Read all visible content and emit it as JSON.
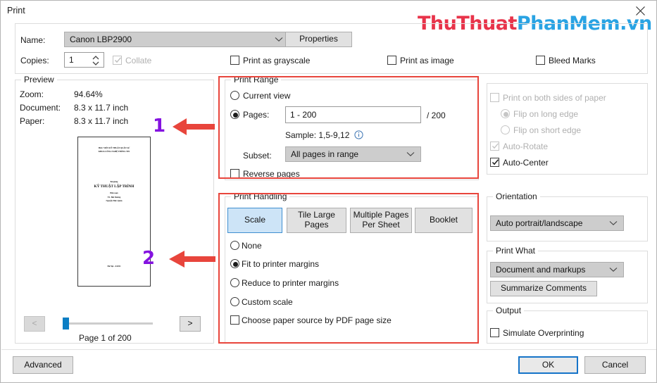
{
  "window": {
    "title": "Print",
    "close_icon": "close-icon"
  },
  "watermark": {
    "part1": "ThuThuat",
    "part2": "PhanMem.vn",
    "color1": "#e8334a",
    "color2": "#29a3e3"
  },
  "printer": {
    "name_label": "Name:",
    "name_value": "Canon LBP2900",
    "properties_button": "Properties",
    "copies_label": "Copies:",
    "copies_value": "1",
    "collate_label": "Collate",
    "collate_checked": true,
    "collate_enabled": false,
    "print_as_grayscale_label": "Print as grayscale",
    "print_as_grayscale_checked": false,
    "print_as_image_label": "Print as image",
    "print_as_image_checked": false,
    "bleed_marks_label": "Bleed Marks",
    "bleed_marks_checked": false
  },
  "preview": {
    "legend": "Preview",
    "zoom_label": "Zoom:",
    "zoom_value": "94.64%",
    "document_label": "Document:",
    "document_value": "8.3 x 11.7 inch",
    "paper_label": "Paper:",
    "paper_value": "8.3 x 11.7 inch",
    "page_status": "Page 1 of 200",
    "prev_button": "<",
    "next_button": ">",
    "prev_enabled": false,
    "next_enabled": true,
    "thumbnail_lines": [
      "HỌC VIỆN KỸ THUẬT QUÂN SỰ",
      "KHOA CÔNG NGHỆ THÔNG TIN",
      "Bài giảng",
      "KỸ THUẬT LẬP TRÌNH",
      "Biên soạn",
      "TS. Bùi Dương",
      "Nguyễn Đức Quân",
      "Hà Nội - 6/2011"
    ]
  },
  "print_range": {
    "legend": "Print Range",
    "current_view_label": "Current view",
    "current_view_selected": false,
    "pages_label": "Pages:",
    "pages_selected": true,
    "pages_value": "1 - 200",
    "total_pages": "/ 200",
    "sample_text": "Sample: 1,5-9,12",
    "info_icon": "info-icon",
    "subset_label": "Subset:",
    "subset_value": "All pages in range",
    "reverse_pages_label": "Reverse pages",
    "reverse_pages_checked": false
  },
  "print_handling": {
    "legend": "Print Handling",
    "tabs": [
      {
        "label": "Scale",
        "selected": true
      },
      {
        "label": "Tile Large\nPages",
        "line1": "Tile Large",
        "line2": "Pages",
        "selected": false
      },
      {
        "label": "Multiple Pages\nPer Sheet",
        "line1": "Multiple Pages",
        "line2": "Per Sheet",
        "selected": false
      },
      {
        "label": "Booklet",
        "selected": false
      }
    ],
    "options": [
      {
        "label": "None",
        "selected": false
      },
      {
        "label": "Fit to printer margins",
        "selected": true
      },
      {
        "label": "Reduce to printer margins",
        "selected": false
      },
      {
        "label": "Custom scale",
        "selected": false
      }
    ],
    "paper_source_label": "Choose paper source by PDF page size",
    "paper_source_checked": false
  },
  "duplex": {
    "both_sides_label": "Print on both sides of paper",
    "both_sides_checked": false,
    "both_sides_enabled": false,
    "flip_long_label": "Flip on long edge",
    "flip_long_selected": true,
    "flip_short_label": "Flip on short edge",
    "flip_short_selected": false,
    "auto_rotate_label": "Auto-Rotate",
    "auto_rotate_checked": true,
    "auto_rotate_enabled": false,
    "auto_center_label": "Auto-Center",
    "auto_center_checked": true
  },
  "orientation": {
    "legend": "Orientation",
    "value": "Auto portrait/landscape"
  },
  "print_what": {
    "legend": "Print What",
    "value": "Document and markups",
    "summarize_button": "Summarize Comments"
  },
  "output": {
    "legend": "Output",
    "simulate_overprinting_label": "Simulate Overprinting",
    "simulate_overprinting_checked": false
  },
  "footer": {
    "advanced_button": "Advanced",
    "ok_button": "OK",
    "cancel_button": "Cancel"
  },
  "annotations": {
    "marker1": "1",
    "marker2": "2",
    "highlight_color": "#e8453c",
    "marker_color": "#8412e0"
  }
}
